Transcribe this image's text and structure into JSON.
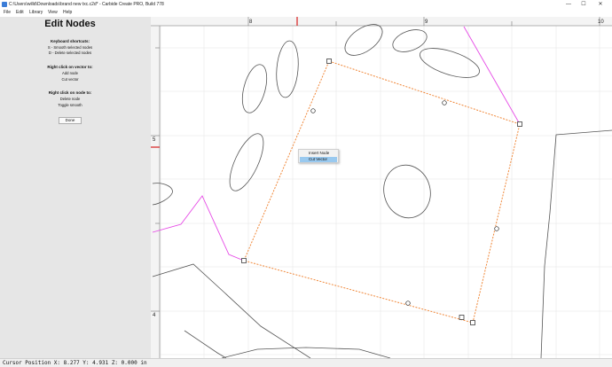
{
  "window": {
    "title": "C:\\Users\\willd\\Downloads\\brand new txc.c2d* - Carbide Create PRO, Build 778"
  },
  "menu": {
    "items": [
      "File",
      "Edit",
      "Library",
      "View",
      "Help"
    ]
  },
  "panel": {
    "title": "Edit Nodes",
    "shortcuts_heading": "Keyboard shortcuts:",
    "shortcuts": [
      "S - Smooth selected nodes",
      "D - Delete selected nodes"
    ],
    "vector_heading": "Right click on vector to:",
    "vector_actions": [
      "Add node",
      "Cut vector"
    ],
    "node_heading": "Right click on node to:",
    "node_actions": [
      "Delete node",
      "Toggle smooth"
    ],
    "done_label": "Done"
  },
  "ruler": {
    "top_labels": [
      "8",
      "9",
      "10"
    ],
    "left_labels": [
      "5",
      "4"
    ]
  },
  "context_menu": {
    "items": [
      {
        "label": "Insert Node",
        "active": false
      },
      {
        "label": "Cut Vector",
        "active": true
      }
    ]
  },
  "status": {
    "text": "Cursor Position X: 8.277 Y: 4.931 Z: 0.000 in"
  },
  "colors": {
    "selected_path": "#f0883a",
    "highlight_path": "#e64ae6",
    "vector_stroke": "#555555",
    "cursor_marker": "#d82020",
    "menu_highlight": "#99c9ef"
  }
}
